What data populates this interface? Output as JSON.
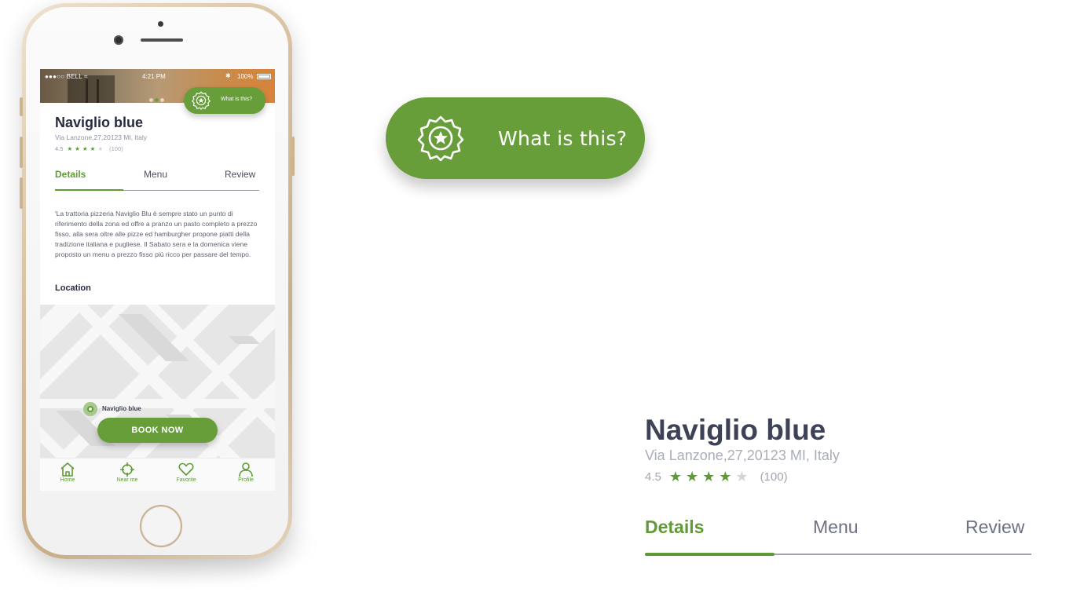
{
  "restaurant": {
    "name": "Naviglio blue",
    "address": "Via Lanzone,27,20123 MI, Italy",
    "rating": "4.5",
    "stars": [
      1,
      1,
      1,
      1,
      0
    ],
    "reviews_count": "(100)"
  },
  "status_bar": {
    "carrier": "●●●○○ BELL ≈",
    "time": "4:21 PM",
    "bluetooth": "✱",
    "battery": "100%"
  },
  "hero": {
    "active_dot": 2,
    "dot_count": 3
  },
  "what_is_this": {
    "label": "What is this?",
    "icon": "award-badge-icon"
  },
  "tabs": [
    {
      "label": "Details",
      "active": true
    },
    {
      "label": "Menu",
      "active": false
    },
    {
      "label": "Review",
      "active": false
    }
  ],
  "description": "'La trattoria pizzeria Naviglio Blu è sempre stato un punto di riferimento della zona ed offre a pranzo un pasto completo a prezzo fisso, alla sera oltre alle pizze ed hamburgher propone piatti della tradizione italiana e pugliese. Il Sabato sera e la domenica viene proposto un menu a prezzo fisso più ricco per passare del tempo.",
  "location": {
    "heading": "Location",
    "pin_label": "Naviglio blue"
  },
  "book_button": "BOOK NOW",
  "bottom_nav": [
    {
      "label": "Home",
      "icon": "home-icon"
    },
    {
      "label": "Near me",
      "icon": "crosshair-icon"
    },
    {
      "label": "Favorite",
      "icon": "heart-icon"
    },
    {
      "label": "Profile",
      "icon": "profile-icon"
    }
  ],
  "colors": {
    "brand_green": "#679e3a",
    "title_dark": "#262b40",
    "muted_text": "#8e93a2"
  }
}
